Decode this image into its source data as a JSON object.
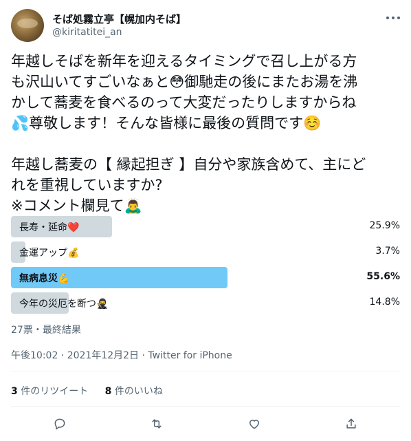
{
  "user": {
    "display_name": "そば処霧立亭【幌加内そば】",
    "handle": "@kiritatitei_an"
  },
  "tweet": {
    "lines": [
      "年越しそばを新年を迎えるタイミングで召し上がる方",
      "も沢山いてすごいなぁと😳御馳走の後にまたお湯を沸",
      "かして蕎麦を食べるのって大変だったりしますからね",
      "💦尊敬します！そんな皆様に最後の質問です☺️",
      "",
      "年越し蕎麦の【 縁起担ぎ 】自分や家族含めて、主にど",
      "れを重視していますか?",
      "※コメント欄見て🙇‍♂️"
    ]
  },
  "poll": {
    "options": [
      {
        "label": "長寿・延命❤️",
        "percent_text": "25.9%",
        "percent": 25.9,
        "winner": false
      },
      {
        "label": "金運アップ💰",
        "percent_text": "3.7%",
        "percent": 3.7,
        "winner": false
      },
      {
        "label": "無病息災💪",
        "percent_text": "55.6%",
        "percent": 55.6,
        "winner": true
      },
      {
        "label": "今年の災厄を断つ🥷",
        "percent_text": "14.8%",
        "percent": 14.8,
        "winner": false
      }
    ],
    "meta": "27票・最終結果"
  },
  "timestamp": "午後10:02 · 2021年12月2日 · Twitter for iPhone",
  "stats": {
    "retweets_count": "3",
    "retweets_label": " 件のリツイート",
    "likes_count": "8",
    "likes_label": " 件のいいね"
  },
  "icons": {
    "more": "more-icon",
    "reply": "reply-icon",
    "retweet": "retweet-icon",
    "like": "like-icon",
    "share": "share-icon"
  },
  "colors": {
    "poll_bar": "#cfd9de",
    "poll_winner_bar": "#71c9f8",
    "secondary_text": "#536471"
  }
}
